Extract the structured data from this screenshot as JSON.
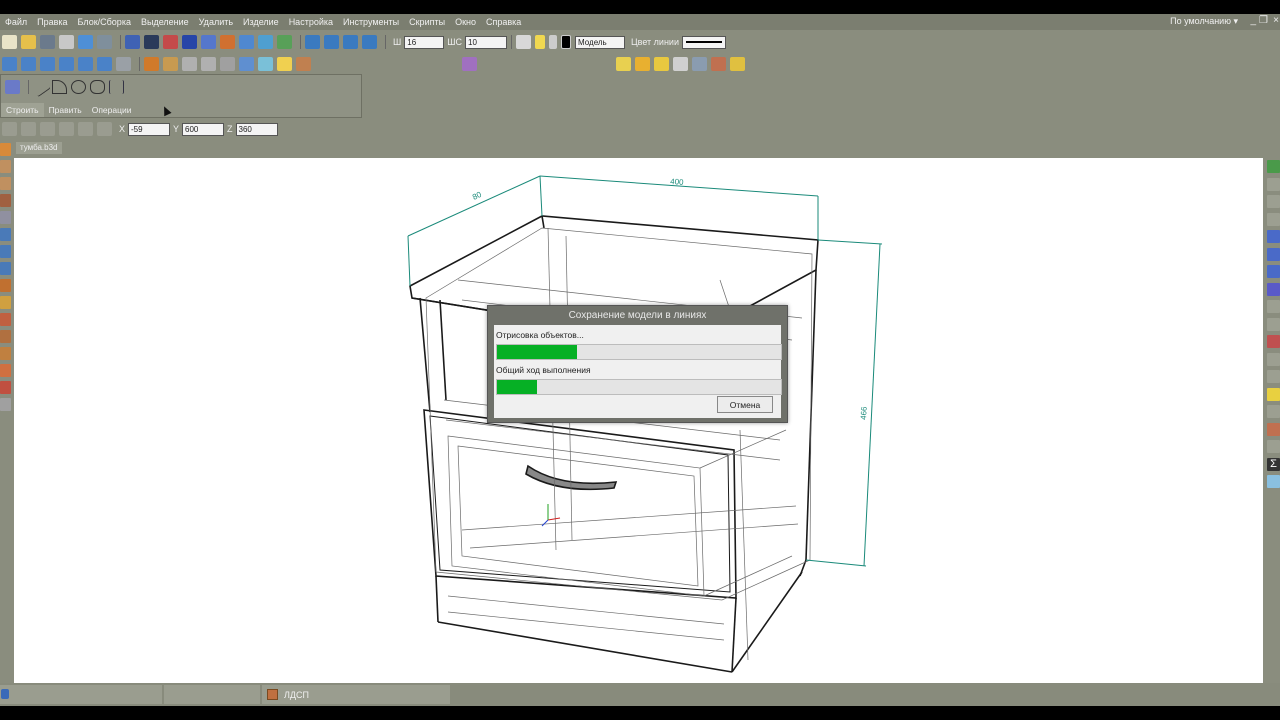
{
  "menu": {
    "items": [
      "Файл",
      "Правка",
      "Блок/Сборка",
      "Выделение",
      "Удалить",
      "Изделие",
      "Настройка",
      "Инструменты",
      "Скрипты",
      "Окно",
      "Справка"
    ],
    "preset": "По умолчанию"
  },
  "toolbar": {
    "width_label": "Ш",
    "width_value": "16",
    "step_label": "ШС",
    "step_value": "10",
    "model_select": "Модель",
    "line_color_label": "Цвет линии"
  },
  "panel": {
    "tabs": [
      "Строить",
      "Править",
      "Операции"
    ]
  },
  "coords": {
    "x_label": "X",
    "x_value": "-59",
    "y_label": "Y",
    "y_value": "600",
    "z_label": "Z",
    "z_value": "360"
  },
  "document": {
    "tab_name": "тумба.b3d"
  },
  "drawing": {
    "dim_width": "400",
    "dim_depth": "80",
    "dim_height": "466"
  },
  "dialog": {
    "title": "Сохранение модели в линиях",
    "task_label": "Отрисовка объектов...",
    "task_progress": 0.28,
    "overall_label": "Общий ход выполнения",
    "overall_progress": 0.14,
    "cancel_label": "Отмена"
  },
  "status": {
    "material": "ЛДСП"
  },
  "colors": {
    "progress": "#06b025",
    "dimension": "#1a8a7a"
  }
}
